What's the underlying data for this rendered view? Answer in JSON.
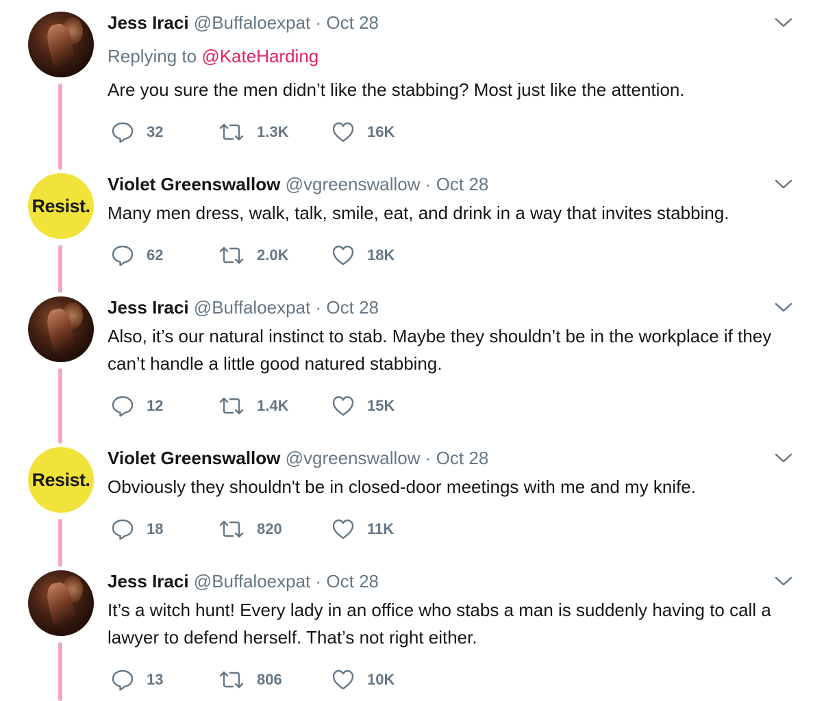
{
  "tweets": [
    {
      "name": "Jess Iraci",
      "handle": "@Buffaloexpat",
      "separator": "·",
      "date": "Oct 28",
      "avatar": "photo",
      "replying_prefix": "Replying to ",
      "replying_to": "@KateHarding",
      "text": "Are you sure the men didn’t like the stabbing? Most just like the attention.",
      "replies": "32",
      "retweets": "1.3K",
      "likes": "16K"
    },
    {
      "name": "Violet Greenswallow",
      "handle": "@vgreenswallow",
      "separator": "·",
      "date": "Oct 28",
      "avatar": "resist",
      "avatar_text": "Resist.",
      "text": "Many men dress, walk, talk, smile, eat, and drink in a way that invites stabbing.",
      "replies": "62",
      "retweets": "2.0K",
      "likes": "18K"
    },
    {
      "name": "Jess Iraci",
      "handle": "@Buffaloexpat",
      "separator": "·",
      "date": "Oct 28",
      "avatar": "photo",
      "text": "Also, it’s our natural instinct to stab. Maybe they shouldn’t be in the workplace if they can’t handle a little good natured stabbing.",
      "replies": "12",
      "retweets": "1.4K",
      "likes": "15K"
    },
    {
      "name": "Violet Greenswallow",
      "handle": "@vgreenswallow",
      "separator": "·",
      "date": "Oct 28",
      "avatar": "resist",
      "avatar_text": "Resist.",
      "text": "Obviously they shouldn't be in closed-door meetings with me and my knife.",
      "replies": "18",
      "retweets": "820",
      "likes": "11K"
    },
    {
      "name": "Jess Iraci",
      "handle": "@Buffaloexpat",
      "separator": "·",
      "date": "Oct 28",
      "avatar": "photo",
      "text": "It’s a witch hunt! Every lady in an office who stabs a man is suddenly having to call a lawyer to defend herself. That’s not right either.",
      "replies": "13",
      "retweets": "806",
      "likes": "10K"
    }
  ],
  "icons": {
    "reply": "reply-icon",
    "retweet": "retweet-icon",
    "like": "heart-icon",
    "menu": "chevron-down-icon"
  },
  "colors": {
    "thread_line": "#f2a8bf",
    "mention": "#e0245e",
    "muted": "#657786",
    "resist_bg": "#f2e33b"
  }
}
